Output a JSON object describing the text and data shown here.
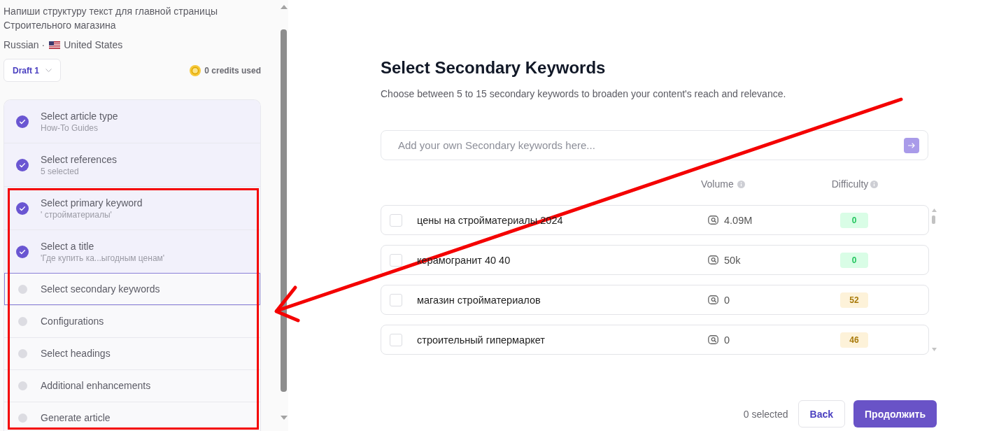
{
  "sidebar": {
    "prompt": "Напиши структуру текст для главной страницы Строительного магазина",
    "language": "Russian ·",
    "country": "United States",
    "draft": {
      "label": "Draft 1"
    },
    "credits": "0 credits used",
    "steps": [
      {
        "title": "Select article type",
        "subtitle": "How-To Guides",
        "completed": true,
        "selected": false
      },
      {
        "title": "Select references",
        "subtitle": "5 selected",
        "completed": true,
        "selected": false
      },
      {
        "title": "Select primary keyword",
        "subtitle": "' стройматериалы'",
        "completed": true,
        "selected": false
      },
      {
        "title": "Select a title",
        "subtitle": "'Где купить ка...ыгодным ценам'",
        "completed": true,
        "selected": false
      },
      {
        "title": "Select secondary keywords",
        "completed": false,
        "selected": true
      },
      {
        "title": "Configurations",
        "completed": false,
        "selected": false
      },
      {
        "title": "Select headings",
        "completed": false,
        "selected": false
      },
      {
        "title": "Additional enhancements",
        "completed": false,
        "selected": false
      },
      {
        "title": "Generate article",
        "completed": false,
        "selected": false
      }
    ]
  },
  "main": {
    "title": "Select Secondary Keywords",
    "description": "Choose between 5 to 15 secondary keywords to broaden your content's reach and relevance.",
    "input": {
      "placeholder": "Add your own Secondary keywords here..."
    },
    "columns": [
      "Volume",
      "Difficulty"
    ],
    "keywords": [
      {
        "keyword": "цены на стройматериалы 2024",
        "checked": false,
        "volume": "4.09M",
        "difficulty": "0",
        "color": "#22c55e"
      },
      {
        "keyword": "керамогранит 40 40",
        "checked": false,
        "volume": "50k",
        "difficulty": "0",
        "color": "#22c55e"
      },
      {
        "keyword": "магазин стройматериалов",
        "checked": false,
        "volume": "0",
        "difficulty": "52",
        "color": "#a87a0a"
      },
      {
        "keyword": "строительный гипермаркет",
        "checked": false,
        "volume": "0",
        "difficulty": "46",
        "color": "#a87a0a"
      }
    ],
    "selected_count": "0 selected",
    "back": "Back",
    "continue": "Продолжить"
  }
}
